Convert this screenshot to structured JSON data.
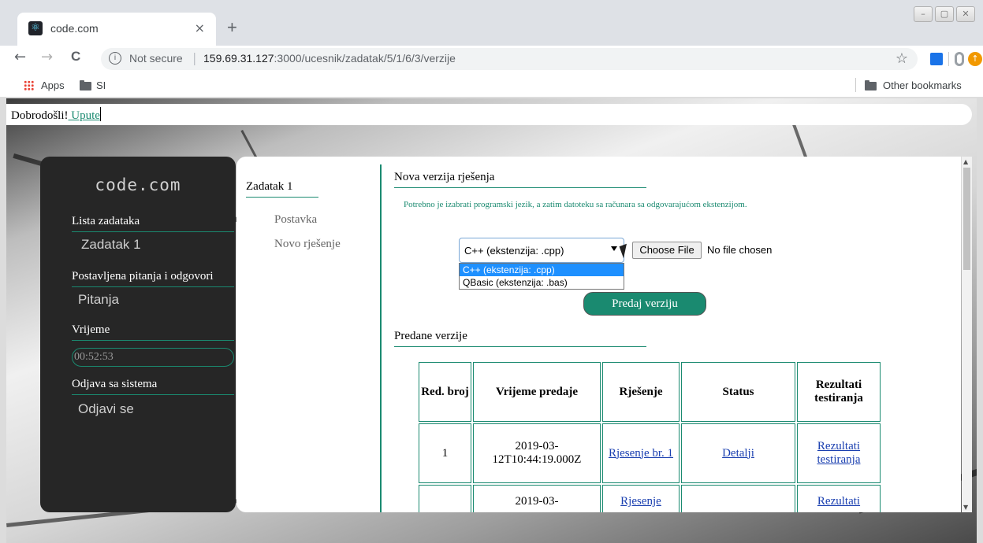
{
  "browser": {
    "tab_title": "code.com",
    "tab_close": "×",
    "new_tab": "+",
    "back": "←",
    "forward": "→",
    "reload": "C",
    "security_label": "Not secure",
    "url_host": "159.69.31.127",
    "url_path": ":3000/ucesnik/zadatak/5/1/6/3/verzije",
    "bookmarks": {
      "apps": "Apps",
      "folder": "SI",
      "other": "Other bookmarks"
    },
    "icons": [
      "back-icon",
      "forward-icon",
      "reload-icon",
      "info-icon",
      "star-icon",
      "apps-icon",
      "folder-icon"
    ]
  },
  "topbar": {
    "welcome": "Dobrodošli!",
    "help_link": " Upute"
  },
  "sidebar": {
    "brand": "code.com",
    "tasks_heading": "Lista zadataka",
    "task_item": "Zadatak 1",
    "qa_heading": "Postavljena pitanja i odgovori",
    "qa_link": "Pitanja",
    "time_heading": "Vrijeme",
    "timer": "00:52:53",
    "logout_heading": "Odjava sa sistema",
    "logout_link": "Odjavi se"
  },
  "subnav": {
    "title": "Zadatak 1",
    "items": [
      "Postavka",
      "Novo rješenje"
    ]
  },
  "new_version": {
    "title": "Nova verzija rješenja",
    "hint": "Potrebno je izabrati programski jezik, a zatim datoteku sa računara sa odgovarajućom ekstenzijom.",
    "language_selected": "C++ (ekstenzija: .cpp)",
    "language_options": [
      "C++ (ekstenzija: .cpp)",
      "QBasic (ekstenzija: .bas)"
    ],
    "file_button": "Choose File",
    "file_status": "No file chosen",
    "submit": "Predaj verziju"
  },
  "submitted": {
    "title": "Predane verzije",
    "headers": [
      "Red. broj",
      "Vrijeme predaje",
      "Rješenje",
      "Status",
      "Rezultati testiranja"
    ],
    "rows": [
      {
        "num": "1",
        "time": "2019-03-12T10:44:19.000Z",
        "solution": "Rjesenje br. 1",
        "status": "Detalji",
        "results": "Rezultati testiranja"
      },
      {
        "num": "",
        "time": "2019-03-",
        "solution": "Rjesenje",
        "status": "",
        "results": "Rezultati"
      }
    ]
  },
  "colors": {
    "accent": "#1a8a70",
    "sidebar_bg": "#262626",
    "link": "#1a3fb0"
  }
}
